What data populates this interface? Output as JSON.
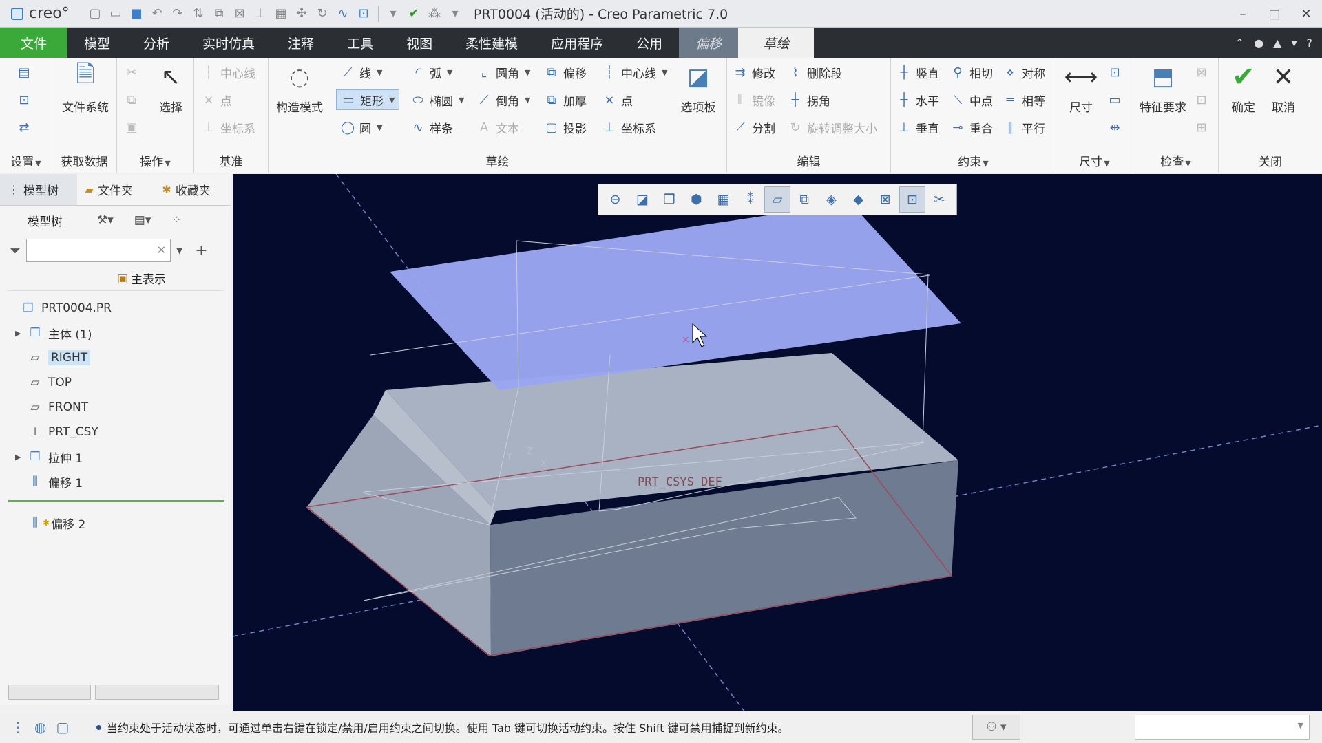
{
  "titlebar": {
    "app_logo": "creo°",
    "window_title": "PRT0004 (活动的) - Creo Parametric 7.0",
    "minimize": "–",
    "maximize": "□",
    "close": "✕"
  },
  "menu": {
    "items": [
      "文件",
      "模型",
      "分析",
      "实时仿真",
      "注释",
      "工具",
      "视图",
      "柔性建模",
      "应用程序",
      "公用",
      "偏移",
      "草绘"
    ]
  },
  "ribbon": {
    "setup": {
      "label": "设置"
    },
    "get_data": {
      "file_system": "文件系统",
      "label": "获取数据"
    },
    "operations": {
      "select": "选择",
      "label": "操作"
    },
    "datum": {
      "centerline": "中心线",
      "point": "点",
      "csys": "坐标系",
      "label": "基准"
    },
    "sketch": {
      "construction_mode": "构造模式",
      "line": "线",
      "rectangle": "矩形",
      "circle": "圆",
      "arc": "弧",
      "ellipse": "椭圆",
      "spline": "样条",
      "fillet": "圆角",
      "chamfer": "倒角",
      "text": "文本",
      "offset": "偏移",
      "thicken": "加厚",
      "project": "投影",
      "centerline": "中心线",
      "point": "点",
      "csys": "坐标系",
      "palette": "选项板",
      "label": "草绘"
    },
    "edit": {
      "modify": "修改",
      "delete_segment": "删除段",
      "mirror": "镜像",
      "corner": "拐角",
      "divide": "分割",
      "rotate_resize": "旋转调整大小",
      "label": "编辑"
    },
    "constrain": {
      "vertical": "竖直",
      "tangent": "相切",
      "symmetric": "对称",
      "horizontal": "水平",
      "midpoint": "中点",
      "equal": "相等",
      "perpendicular": "垂直",
      "coincident": "重合",
      "parallel": "平行",
      "label": "约束"
    },
    "dimension": {
      "dimension": "尺寸",
      "label": "尺寸"
    },
    "inspect": {
      "feature_requirements": "特征要求",
      "label": "检查"
    },
    "close": {
      "ok": "确定",
      "cancel": "取消",
      "label": "关闭"
    }
  },
  "left_panel": {
    "tabs": [
      "模型树",
      "文件夹",
      "收藏夹"
    ],
    "tree_label": "模型树",
    "filter_placeholder": "",
    "display_header": "主表示",
    "nodes": [
      {
        "label": "PRT0004.PR",
        "icon": "part-icon"
      },
      {
        "label": "主体 (1)",
        "icon": "body-icon"
      },
      {
        "label": "RIGHT",
        "icon": "datum-plane-icon"
      },
      {
        "label": "TOP",
        "icon": "datum-plane-icon"
      },
      {
        "label": "FRONT",
        "icon": "datum-plane-icon"
      },
      {
        "label": "PRT_CSY",
        "icon": "csys-icon"
      },
      {
        "label": "拉伸 1",
        "icon": "extrude-icon"
      },
      {
        "label": "偏移 1",
        "icon": "offset-icon"
      },
      {
        "label": "偏移 2",
        "icon": "offset-icon"
      }
    ]
  },
  "viewport": {
    "csys_label": "PRT_CSYS_DEF",
    "axis_x": "X",
    "axis_y": "Y",
    "axis_z": "Z",
    "background_color": "#050b2c",
    "plane_color": "#9aa6f2",
    "solid_color": "#8a95a8"
  },
  "statusbar": {
    "message": "当约束处于活动状态时，可通过单击右键在锁定/禁用/启用约束之间切换。使用 Tab 键可切换活动约束。按住 Shift 键可禁用捕捉到新约束。"
  }
}
